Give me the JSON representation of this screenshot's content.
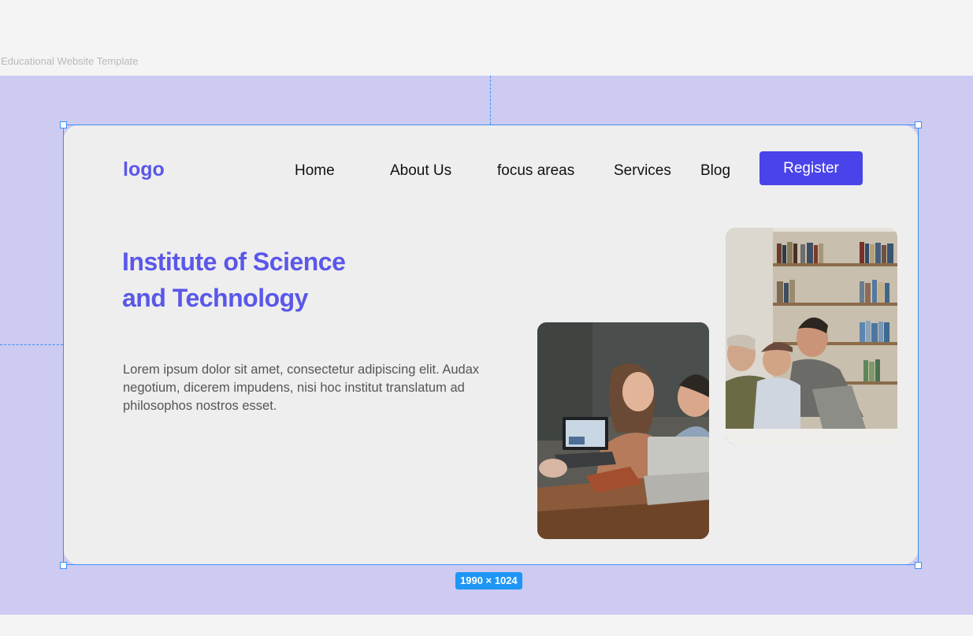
{
  "canvas": {
    "frame_label": "Educational Website Template",
    "size_badge": "1990 × 1024"
  },
  "site": {
    "logo": "logo",
    "nav": [
      {
        "label": "Home"
      },
      {
        "label": "About Us"
      },
      {
        "label": "focus areas"
      },
      {
        "label": "Services"
      },
      {
        "label": "Blog"
      }
    ],
    "register_label": "Register",
    "hero": {
      "title_line1": "Institute of Science",
      "title_line2": "and Technology",
      "body": "Lorem ipsum dolor sit amet, consectetur adipiscing elit. Audax negotium, dicerem impudens, nisi hoc institut translatum ad philosophos nostros esset."
    },
    "images": [
      {
        "name": "students-laptops-photo"
      },
      {
        "name": "students-library-photo"
      }
    ]
  },
  "colors": {
    "accent": "#5a57e9",
    "button": "#4a43ea",
    "canvas_bg": "#cdcbf1",
    "selection": "#3d8ff5"
  }
}
